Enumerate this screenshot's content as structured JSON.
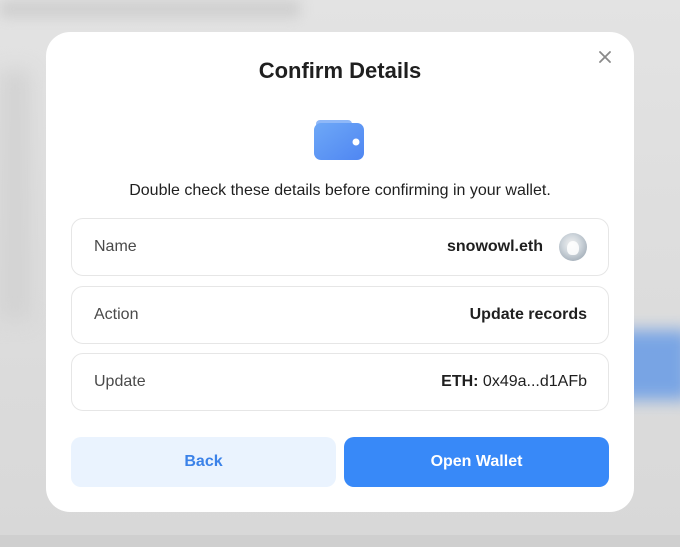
{
  "modal": {
    "title": "Confirm Details",
    "subtitle": "Double check these details before confirming in your wallet.",
    "close_icon": "close-icon",
    "wallet_icon": "wallet-icon"
  },
  "details": [
    {
      "label": "Name",
      "value": "snowowl.eth",
      "has_avatar": true
    },
    {
      "label": "Action",
      "value": "Update records"
    },
    {
      "label": "Update",
      "value_prefix": "ETH:",
      "value": "0x49a...d1AFb"
    }
  ],
  "buttons": {
    "back_label": "Back",
    "open_wallet_label": "Open Wallet"
  },
  "colors": {
    "primary": "#3889f8",
    "secondary_bg": "#eaf3fe",
    "secondary_text": "#3b82e8",
    "text": "#1f1f1f"
  }
}
